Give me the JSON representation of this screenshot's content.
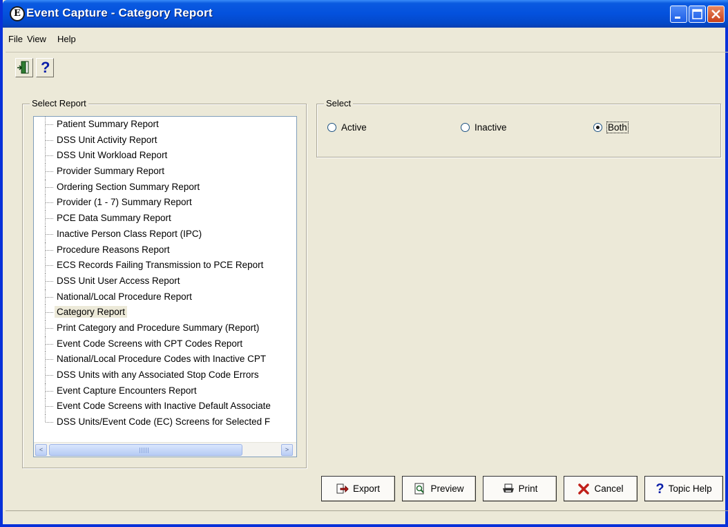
{
  "window": {
    "title": "Event Capture - Category Report",
    "icon_letter": "E",
    "controls": [
      "minimize-icon",
      "maximize-icon",
      "close-icon"
    ]
  },
  "menu": {
    "file": "File",
    "view": "View",
    "help": "Help"
  },
  "toolbar": {
    "exit_icon": "exit-door-icon",
    "help_icon": "question-mark-icon",
    "help_glyph": "?"
  },
  "report_panel": {
    "legend": "Select Report",
    "items": [
      "Patient Summary Report",
      "DSS Unit Activity Report",
      "DSS Unit Workload Report",
      "Provider Summary Report",
      "Ordering Section Summary Report",
      "Provider (1 - 7) Summary Report",
      "PCE Data Summary Report",
      "Inactive Person Class Report (IPC)",
      "Procedure Reasons Report",
      "ECS Records Failing Transmission to PCE Report",
      "DSS Unit User Access Report",
      "National/Local Procedure Report",
      "Category Report",
      "Print Category and Procedure Summary (Report)",
      "Event Code Screens with CPT Codes Report",
      "National/Local Procedure Codes with Inactive CPT",
      "DSS Units with any Associated Stop Code Errors",
      "Event Capture Encounters Report",
      "Event Code Screens with Inactive Default Associate",
      "DSS Units/Event Code (EC) Screens for Selected F"
    ],
    "selected": "Category Report",
    "scroll_left_glyph": "<",
    "scroll_right_glyph": ">"
  },
  "select_panel": {
    "legend": "Select",
    "options": [
      "Active",
      "Inactive",
      "Both"
    ],
    "selected": "Both"
  },
  "buttons": {
    "export": "Export",
    "preview": "Preview",
    "print": "Print",
    "cancel": "Cancel",
    "topic_help": "Topic Help"
  },
  "colors": {
    "titlebar": "#0451dd",
    "window_bg": "#ece9d8",
    "close_button": "#c8401a",
    "cancel_icon": "#c0201a",
    "help_icon": "#0a1ea8"
  }
}
